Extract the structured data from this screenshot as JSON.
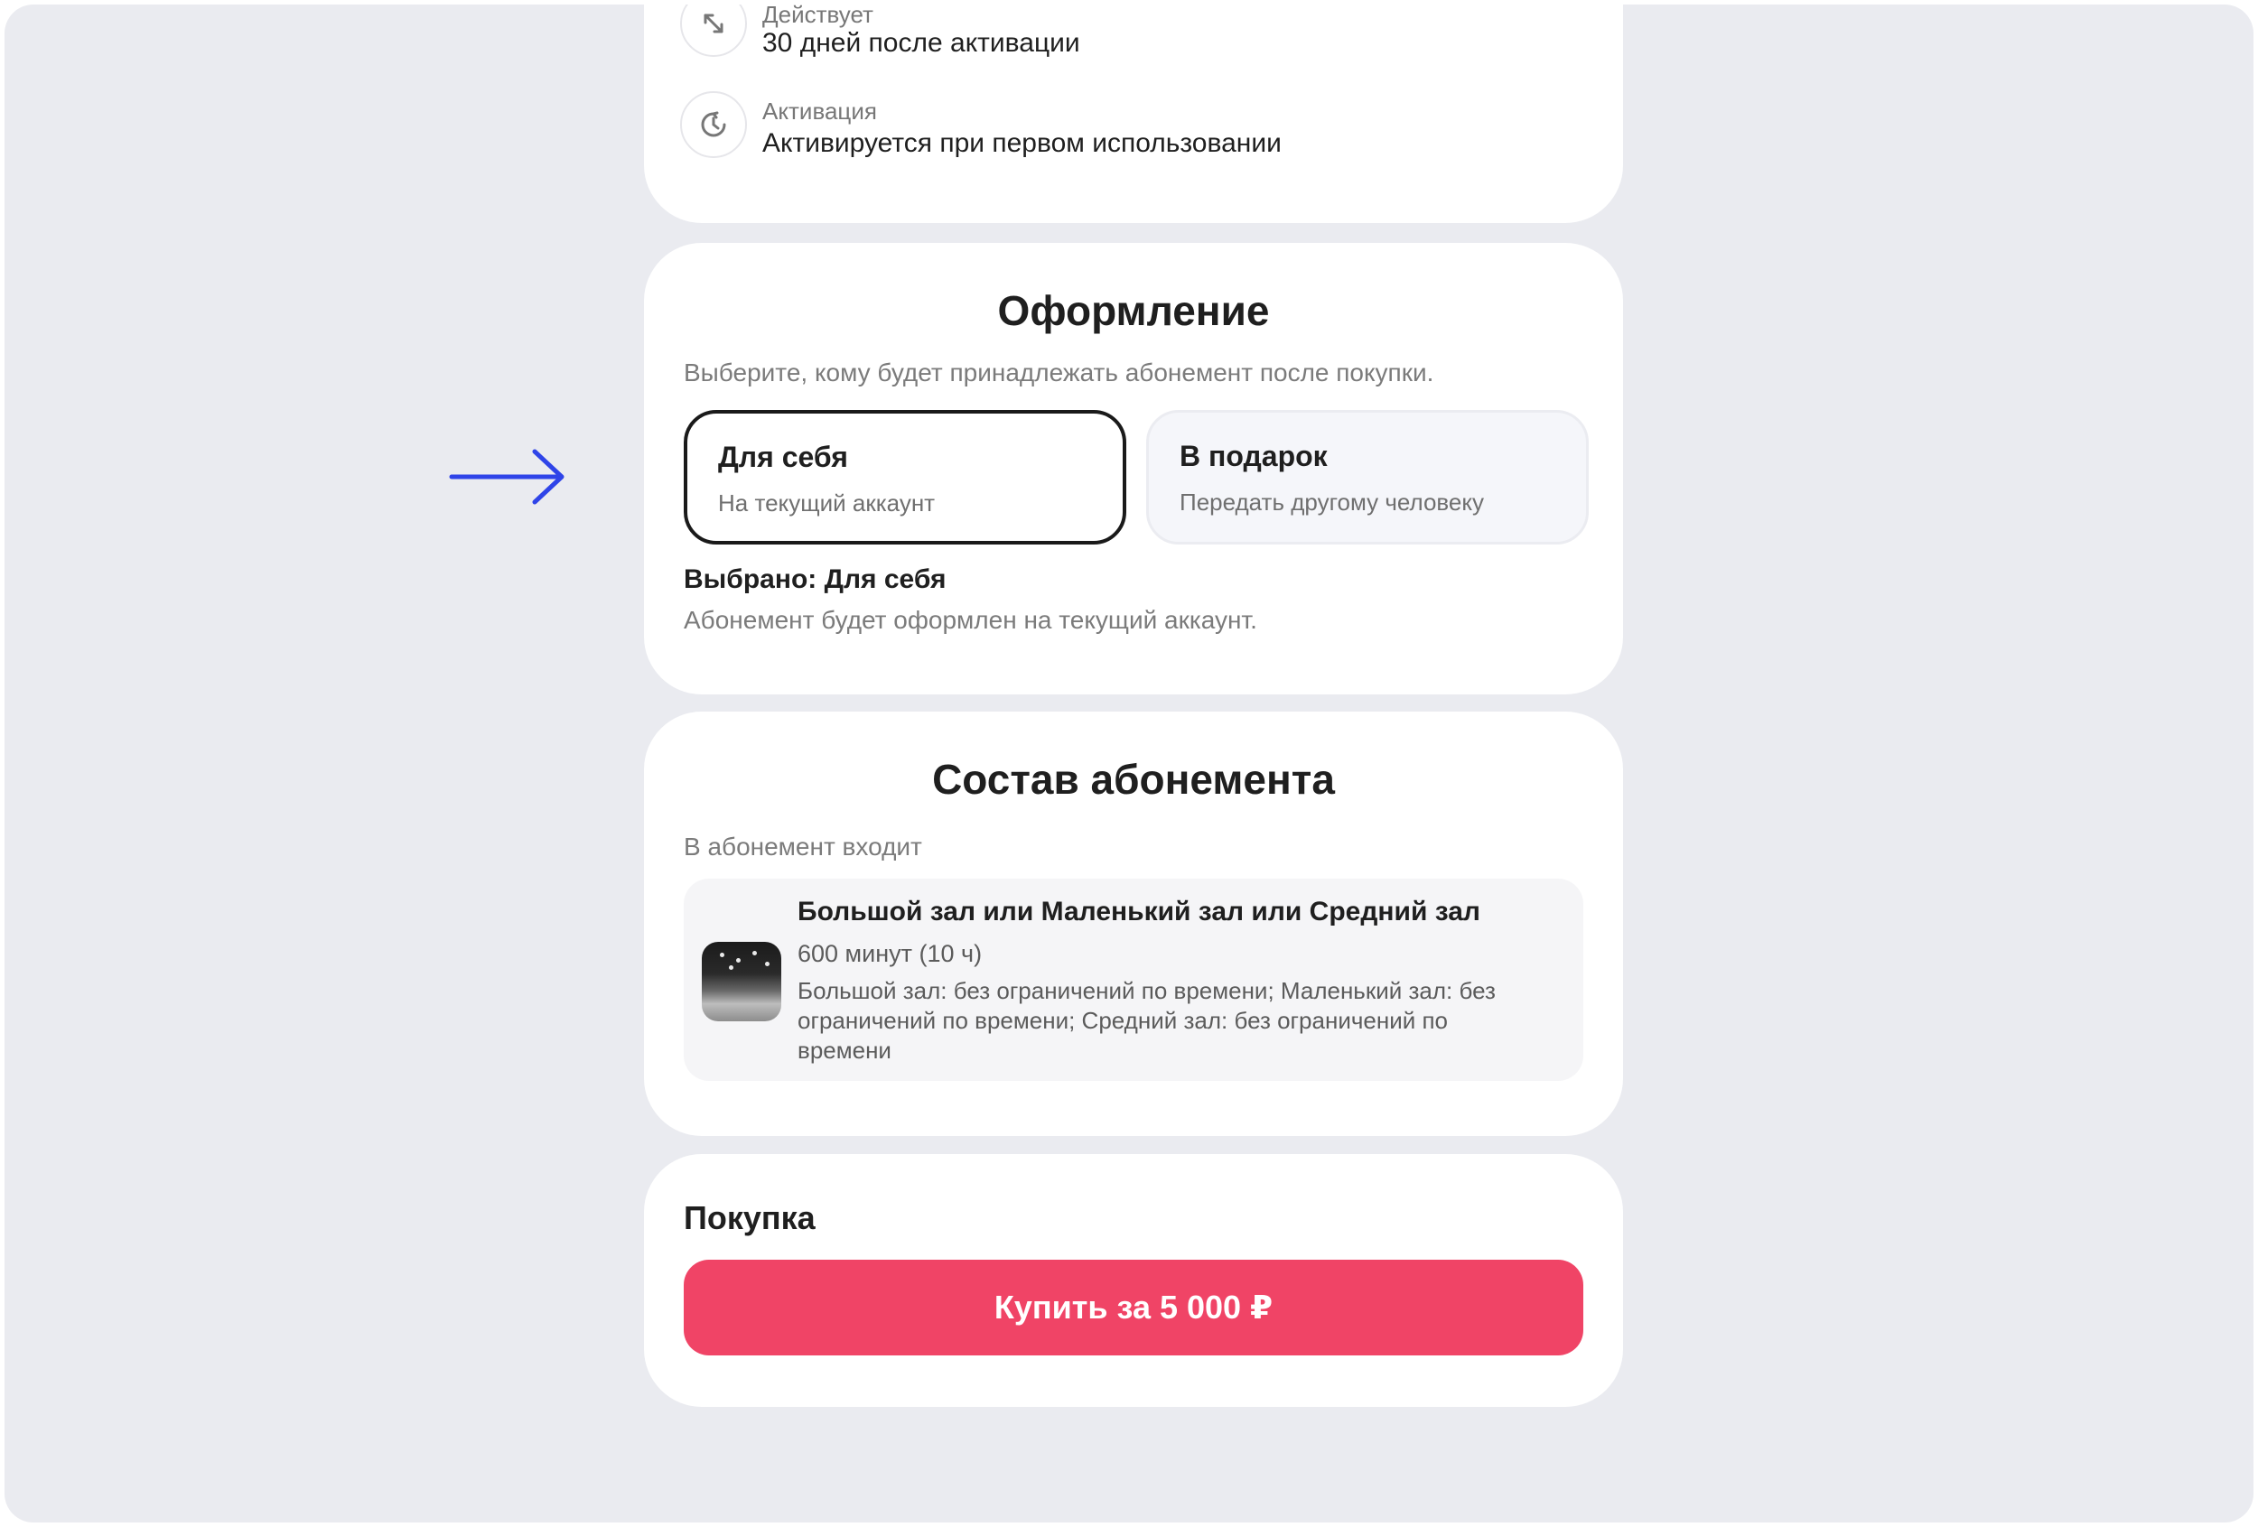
{
  "info": {
    "validity_label": "Действует",
    "validity_value": "30 дней после активации",
    "activation_label": "Активация",
    "activation_value": "Активируется при первом использовании"
  },
  "registration": {
    "title": "Оформление",
    "subtitle": "Выберите, кому будет принадлежать абонемент после покупки.",
    "options": [
      {
        "title": "Для себя",
        "subtitle": "На текущий аккаунт",
        "selected": true
      },
      {
        "title": "В подарок",
        "subtitle": "Передать другому человеку",
        "selected": false
      }
    ],
    "selected_label": "Выбрано: Для себя",
    "selected_desc": "Абонемент будет оформлен на текущий аккаунт."
  },
  "composition": {
    "title": "Состав абонемента",
    "includes_label": "В абонемент входит",
    "item": {
      "title": "Большой зал или Маленький зал или Средний зал",
      "duration": "600 минут (10 ч)",
      "description": "Большой зал: без ограничений по времени; Маленький зал: без ограничений по времени; Средний зал: без ограничений по времени"
    }
  },
  "purchase": {
    "title": "Покупка",
    "button_label": "Купить за 5 000 ₽"
  },
  "colors": {
    "background": "#eaebf0",
    "accent_button": "#f04466",
    "arrow": "#2f44e8"
  },
  "icons": {
    "validity": "expand-arrows-icon",
    "activation": "clock-refresh-icon",
    "pointer": "arrow-right-icon"
  }
}
